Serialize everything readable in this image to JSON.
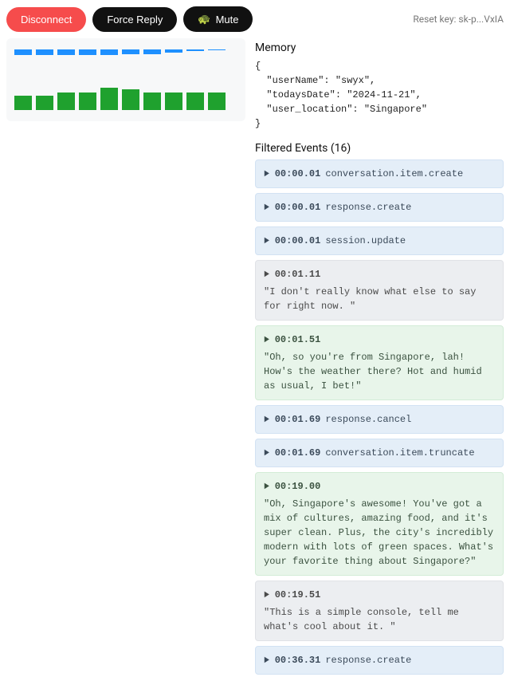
{
  "toolbar": {
    "disconnect": "Disconnect",
    "forceReply": "Force Reply",
    "mute": "Mute",
    "muteIcon": "🐢",
    "resetKey": "Reset key: sk-p...VxIA"
  },
  "viz": {
    "blueBars": [
      7,
      7,
      7,
      7,
      7,
      6,
      6,
      4,
      2,
      1
    ],
    "greenBars": [
      18,
      18,
      22,
      22,
      28,
      26,
      22,
      22,
      22,
      22
    ]
  },
  "memory": {
    "title": "Memory",
    "text": "{\n  \"userName\": \"swyx\",\n  \"todaysDate\": \"2024-11-21\",\n  \"user_location\": \"Singapore\"\n}"
  },
  "filtered": {
    "title": "Filtered Events (16)",
    "count": 16,
    "events": [
      {
        "ts": "00:00.01",
        "name": "conversation.item.create",
        "tone": "blue"
      },
      {
        "ts": "00:00.01",
        "name": "response.create",
        "tone": "blue"
      },
      {
        "ts": "00:00.01",
        "name": "session.update",
        "tone": "blue"
      },
      {
        "ts": "00:01.11",
        "body": "\"I don't really know what else to say for right now. \"",
        "tone": "gray"
      },
      {
        "ts": "00:01.51",
        "body": "\"Oh, so you're from Singapore, lah! How's the weather there? Hot and humid as usual, I bet!\"",
        "tone": "green"
      },
      {
        "ts": "00:01.69",
        "name": "response.cancel",
        "tone": "blue"
      },
      {
        "ts": "00:01.69",
        "name": "conversation.item.truncate",
        "tone": "blue"
      },
      {
        "ts": "00:19.00",
        "body": "\"Oh, Singapore's awesome! You've got a mix of cultures, amazing food, and it's super clean. Plus, the city's incredibly modern with lots of green spaces. What's your favorite thing about Singapore?\"",
        "tone": "green"
      },
      {
        "ts": "00:19.51",
        "body": "\"This is a simple console, tell me what's cool about it. \"",
        "tone": "gray"
      },
      {
        "ts": "00:36.31",
        "name": "response.create",
        "tone": "blue"
      }
    ]
  }
}
